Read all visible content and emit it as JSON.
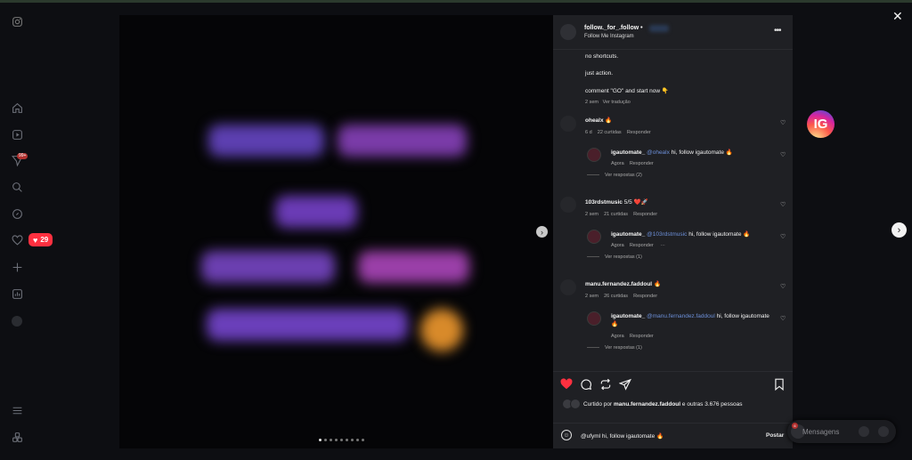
{
  "notifications": {
    "count": "29"
  },
  "post": {
    "username": "follow._for_.follow",
    "separator": "•",
    "subtitle": "Follow Me Instagram",
    "caption": [
      "no shortcuts.",
      "just action.",
      "comment \"GO\" and start now 👇"
    ],
    "caption_time": "2 sem",
    "translate": "Ver tradução"
  },
  "comments": [
    {
      "username": "ohealx",
      "text": "🔥",
      "time": "6 d",
      "likes": "22 curtidas",
      "reply_label": "Responder",
      "reply": {
        "username": "igautomate_",
        "mention": "@ohealx",
        "text": "hi, follow igautomate 🔥",
        "time": "Agora",
        "reply_label": "Responder"
      },
      "view_replies": "Ver respostas (2)"
    },
    {
      "username": "103rdstmusic",
      "text": "5/5 ❤️🚀",
      "time": "2 sem",
      "likes": "21 curtidas",
      "reply_label": "Responder",
      "reply": {
        "username": "igautomate_",
        "mention": "@103rdstmusic",
        "text": "hi, follow igautomate 🔥",
        "time": "Agora",
        "reply_label": "Responder",
        "more": "···"
      },
      "view_replies": "Ver respostas (1)"
    },
    {
      "username": "manu.fernandez.faddoul",
      "text": "🔥",
      "time": "2 sem",
      "likes": "26 curtidas",
      "reply_label": "Responder",
      "reply": {
        "username": "igautomate_",
        "mention": "@manu.fernandez.faddoul",
        "text": "hi, follow igautomate 🔥",
        "time": "Agora",
        "reply_label": "Responder"
      },
      "view_replies": "Ver respostas (1)"
    }
  ],
  "liked_by": {
    "prefix": "Curtido por",
    "user": "manu.fernandez.faddoul",
    "suffix": "e outras 3.676 pessoas"
  },
  "comment_input": {
    "value": "@ufyml  hi, follow igautomate 🔥",
    "post_label": "Postar"
  },
  "messages": {
    "label": "Mensagens",
    "badge": "6"
  },
  "logo_text": "IG",
  "colors": {
    "like_red": "#ff3040",
    "mention_blue": "#6c8fd8",
    "panel_bg": "#1f2024"
  },
  "carousel": {
    "count": 9,
    "active": 1
  }
}
